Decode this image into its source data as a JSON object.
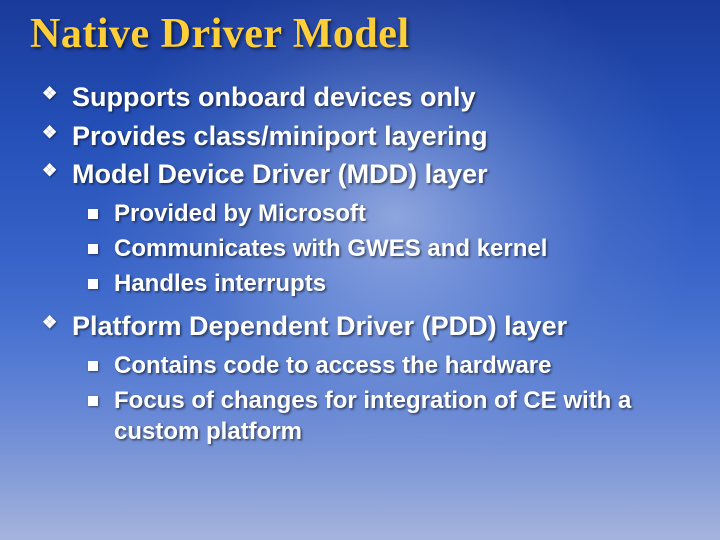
{
  "title": "Native Driver Model",
  "bullets": {
    "a": "Supports onboard devices only",
    "b": "Provides class/miniport layering",
    "c": "Model Device Driver (MDD) layer",
    "c_sub": {
      "a": "Provided by Microsoft",
      "b": "Communicates with GWES and kernel",
      "c": "Handles interrupts"
    },
    "d": "Platform Dependent Driver (PDD) layer",
    "d_sub": {
      "a": "Contains code to access the hardware",
      "b": "Focus of changes for integration of CE with a custom platform"
    }
  }
}
